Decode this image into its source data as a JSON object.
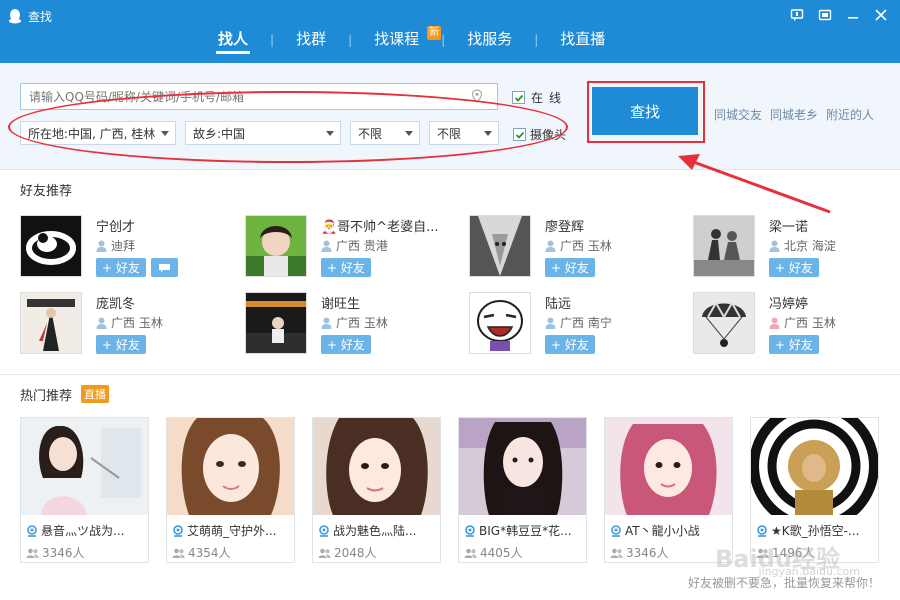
{
  "window": {
    "title": "查找"
  },
  "tabs": [
    {
      "label": "找人",
      "active": true
    },
    {
      "label": "找群"
    },
    {
      "label": "找课程",
      "badge": "新"
    },
    {
      "label": "找服务"
    },
    {
      "label": "找直播"
    }
  ],
  "search": {
    "placeholder": "请输入QQ号码/昵称/关键词/手机号/邮箱",
    "online_label": "在线",
    "online_checked": true,
    "location": "所在地:中国, 广西, 桂林",
    "hometown": "故乡:中国",
    "filter1": "不限",
    "filter2": "不限",
    "camera_label": "摄像头",
    "camera_checked": true,
    "button": "查找",
    "links": [
      "同城交友",
      "同城老乡",
      "附近的人"
    ]
  },
  "friends": {
    "title": "好友推荐",
    "add_label": "+ 好友",
    "items": [
      {
        "name": "宁创才",
        "location": "迪拜",
        "avatar": "swirl"
      },
      {
        "name": "🎅哥不帅^老婆自...",
        "location": "广西 贵港",
        "avatar": "boy-green"
      },
      {
        "name": "廖登辉",
        "location": "广西 玉林",
        "avatar": "gray-hair"
      },
      {
        "name": "梁一诺",
        "location": "北京 海淀",
        "avatar": "dancers"
      },
      {
        "name": "庞凯冬",
        "location": "广西 玉林",
        "avatar": "poster"
      },
      {
        "name": "谢旺生",
        "location": "广西 玉林",
        "avatar": "dark-room"
      },
      {
        "name": "陆远",
        "location": "广西 南宁",
        "avatar": "cartoon"
      },
      {
        "name": "冯婷婷",
        "location": "广西 玉林",
        "avatar": "parachute"
      }
    ]
  },
  "hot": {
    "title": "热门推荐",
    "badge": "直播",
    "items": [
      {
        "title": "悬音灬ツ战为...",
        "count": "3346人"
      },
      {
        "title": "艾萌萌_守护外...",
        "count": "4354人"
      },
      {
        "title": "战为魅色灬陆...",
        "count": "2048人"
      },
      {
        "title": "BIG*韩豆豆*花...",
        "count": "4405人"
      },
      {
        "title": "AT丶龍小小战",
        "count": "3346人"
      },
      {
        "title": "★K歌_孙悟空-...",
        "count": "1496人"
      }
    ]
  },
  "footer": {
    "text": "好友被删不要急，批量恢复来帮你！"
  },
  "watermark": {
    "main": "Baidu经验",
    "sub": "jingyan.baidu.com"
  },
  "colors": {
    "primary": "#1f8ad6",
    "annotation": "#e8303a",
    "badge": "#f39a1b"
  }
}
